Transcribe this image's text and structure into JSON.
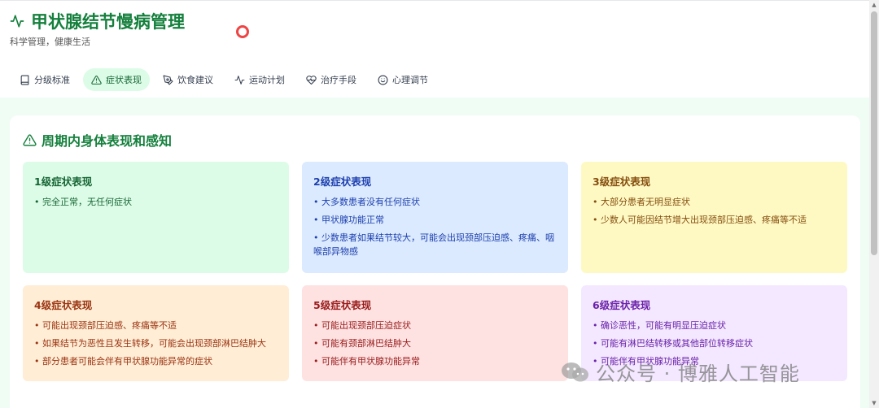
{
  "app": {
    "title": "甲状腺结节慢病管理",
    "subtitle": "科学管理，健康生活"
  },
  "tabs": [
    {
      "label": "分级标准",
      "icon": "book-icon",
      "active": false
    },
    {
      "label": "症状表现",
      "icon": "alert-triangle-icon",
      "active": true
    },
    {
      "label": "饮食建议",
      "icon": "pen-icon",
      "active": false
    },
    {
      "label": "运动计划",
      "icon": "activity-icon",
      "active": false
    },
    {
      "label": "治疗手段",
      "icon": "heart-pulse-icon",
      "active": false
    },
    {
      "label": "心理调节",
      "icon": "smile-icon",
      "active": false
    }
  ],
  "section": {
    "title": "周期内身体表现和感知"
  },
  "cards": [
    {
      "title": "1级症状表现",
      "items": [
        "完全正常，无任何症状"
      ]
    },
    {
      "title": "2级症状表现",
      "items": [
        "大多数患者没有任何症状",
        "甲状腺功能正常",
        "少数患者如果结节较大，可能会出现颈部压迫感、疼痛、咽喉部异物感"
      ]
    },
    {
      "title": "3级症状表现",
      "items": [
        "大部分患者无明显症状",
        "少数人可能因结节增大出现颈部压迫感、疼痛等不适"
      ]
    },
    {
      "title": "4级症状表现",
      "items": [
        "可能出现颈部压迫感、疼痛等不适",
        "如果结节为恶性且发生转移，可能会出现颈部淋巴结肿大",
        "部分患者可能会伴有甲状腺功能异常的症状"
      ]
    },
    {
      "title": "5级症状表现",
      "items": [
        "可能出现颈部压迫症状",
        "可能有颈部淋巴结肿大",
        "可能伴有甲状腺功能异常"
      ]
    },
    {
      "title": "6级症状表现",
      "items": [
        "确诊恶性，可能有明显压迫症状",
        "可能有淋巴结转移或其他部位转移症状",
        "可能伴有甲状腺功能异常"
      ]
    }
  ],
  "watermark": {
    "text": "公众号 · 博雅人工智能"
  },
  "colors": {
    "brand": "#15803d",
    "active_tab_bg": "#dcfce7",
    "page_bg": "#f0fdf4"
  }
}
